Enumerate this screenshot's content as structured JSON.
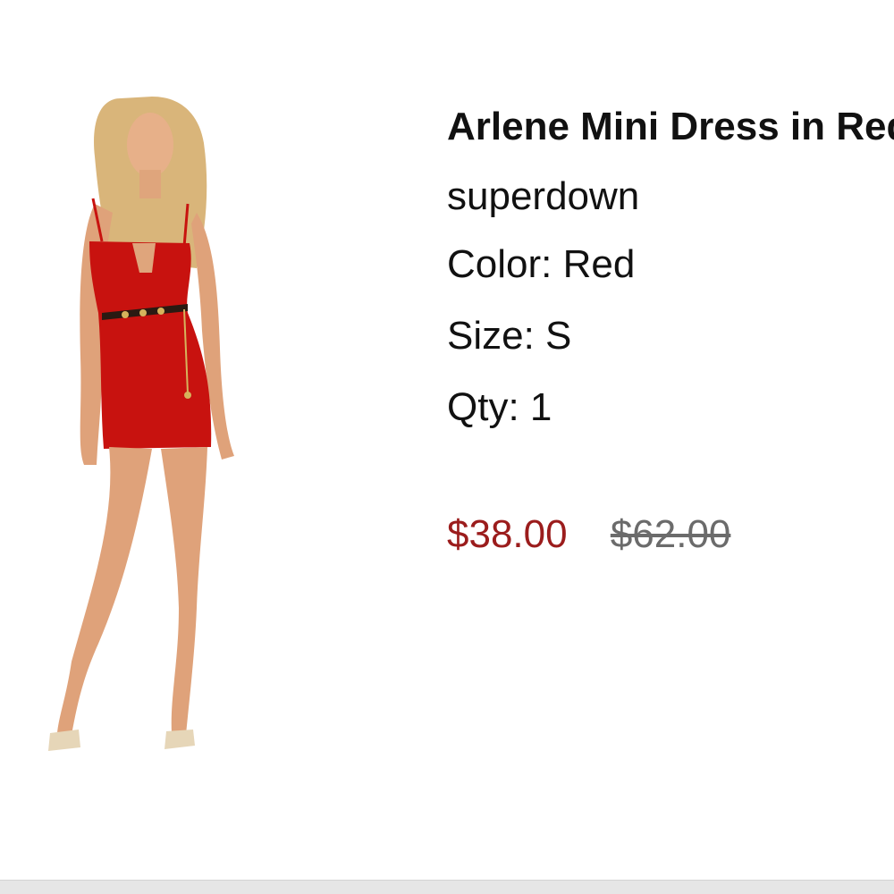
{
  "product": {
    "title": "Arlene Mini Dress in Red",
    "brand": "superdown",
    "color_line": "Color: Red",
    "size_line": "Size: S",
    "qty_line": "Qty: 1",
    "sale_price": "$38.00",
    "original_price": "$62.00",
    "image_icon": "product-photo-red-mini-dress"
  },
  "colors": {
    "sale": "#9b1c1c",
    "muted": "#6b6b6b",
    "dress": "#c8120f"
  }
}
